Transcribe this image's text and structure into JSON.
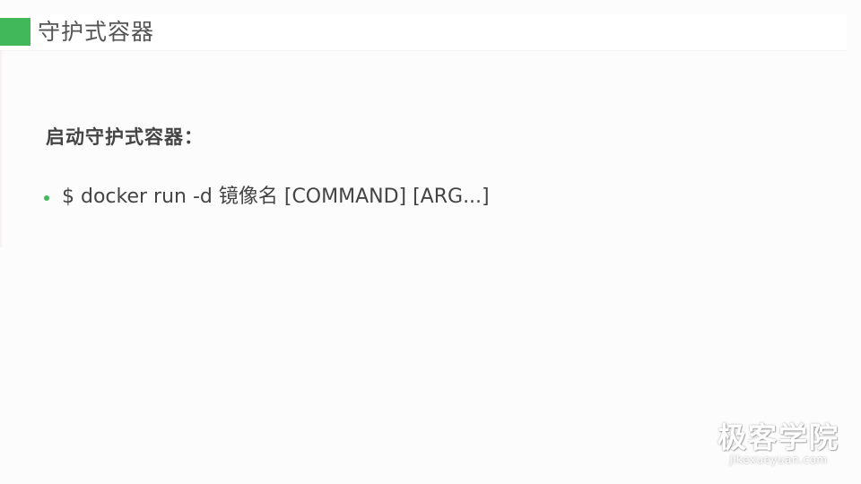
{
  "slide": {
    "title": "守护式容器",
    "subheading": "启动守护式容器：",
    "bullets": [
      "$ docker run -d 镜像名 [COMMAND] [ARG...]"
    ]
  },
  "watermark": {
    "main": "极客学院",
    "sub": "jikexueyuan.com"
  },
  "colors": {
    "accent": "#41b85a",
    "text": "#444444",
    "background": "#fcfcfd"
  }
}
